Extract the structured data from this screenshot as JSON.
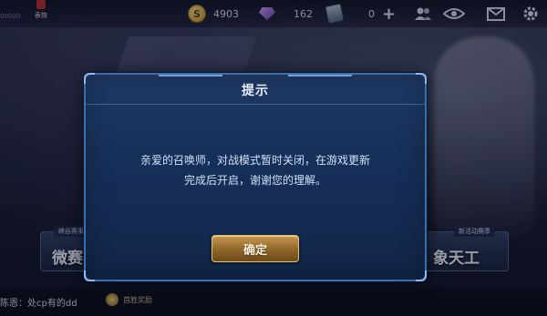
{
  "topbar": {
    "left_text": "00000",
    "rank_label": "表恢",
    "gold": "4903",
    "gems": "162",
    "vouchers": "0",
    "add_label": "+"
  },
  "side_cards": {
    "left_tag": "峡谷赛事",
    "left_big": "微赛",
    "right_tag": "新活动赛季",
    "right_big": "象天工"
  },
  "bottom": {
    "chat": "陈恩：处cp有的dd",
    "reward": "首胜奖励"
  },
  "dialog": {
    "title": "提示",
    "message_line1": "亲爱的召唤师，对战模式暂时关闭，在游戏更新",
    "message_line2": "完成后开启，谢谢您的理解。",
    "ok_label": "确定"
  },
  "colors": {
    "dialog_bg": "#17305a",
    "dialog_border": "#3d6fa8",
    "button_gold": "#8e6428"
  }
}
